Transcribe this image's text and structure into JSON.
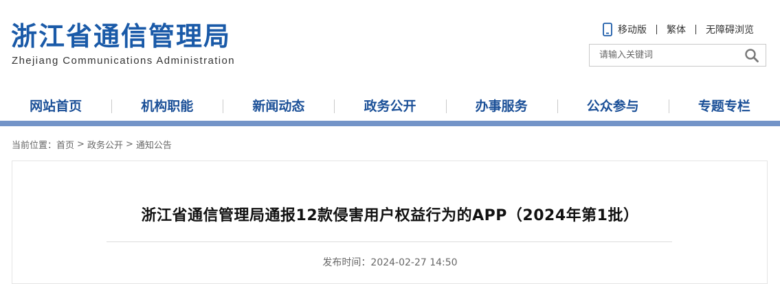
{
  "header": {
    "site_title": "浙江省通信管理局",
    "site_subtitle": "Zhejiang Communications Administration",
    "top_links": [
      "移动版",
      "繁体",
      "无障碍浏览"
    ],
    "search": {
      "placeholder": "请输入关键词"
    },
    "icons": {
      "mobile": "phone-icon",
      "search": "search-icon"
    },
    "brand_color": "#1a5aa8"
  },
  "nav": {
    "items": [
      "网站首页",
      "机构职能",
      "新闻动态",
      "政务公开",
      "办事服务",
      "公众参与",
      "专题专栏"
    ],
    "bar_color": "#7394c8"
  },
  "breadcrumb": {
    "label": "当前位置：",
    "items": [
      "首页",
      "政务公开",
      "通知公告"
    ],
    "separator": ">"
  },
  "article": {
    "title": "浙江省通信管理局通报12款侵害用户权益行为的APP（2024年第1批）",
    "publish_label": "发布时间：",
    "publish_time": "2024-02-27 14:50"
  }
}
